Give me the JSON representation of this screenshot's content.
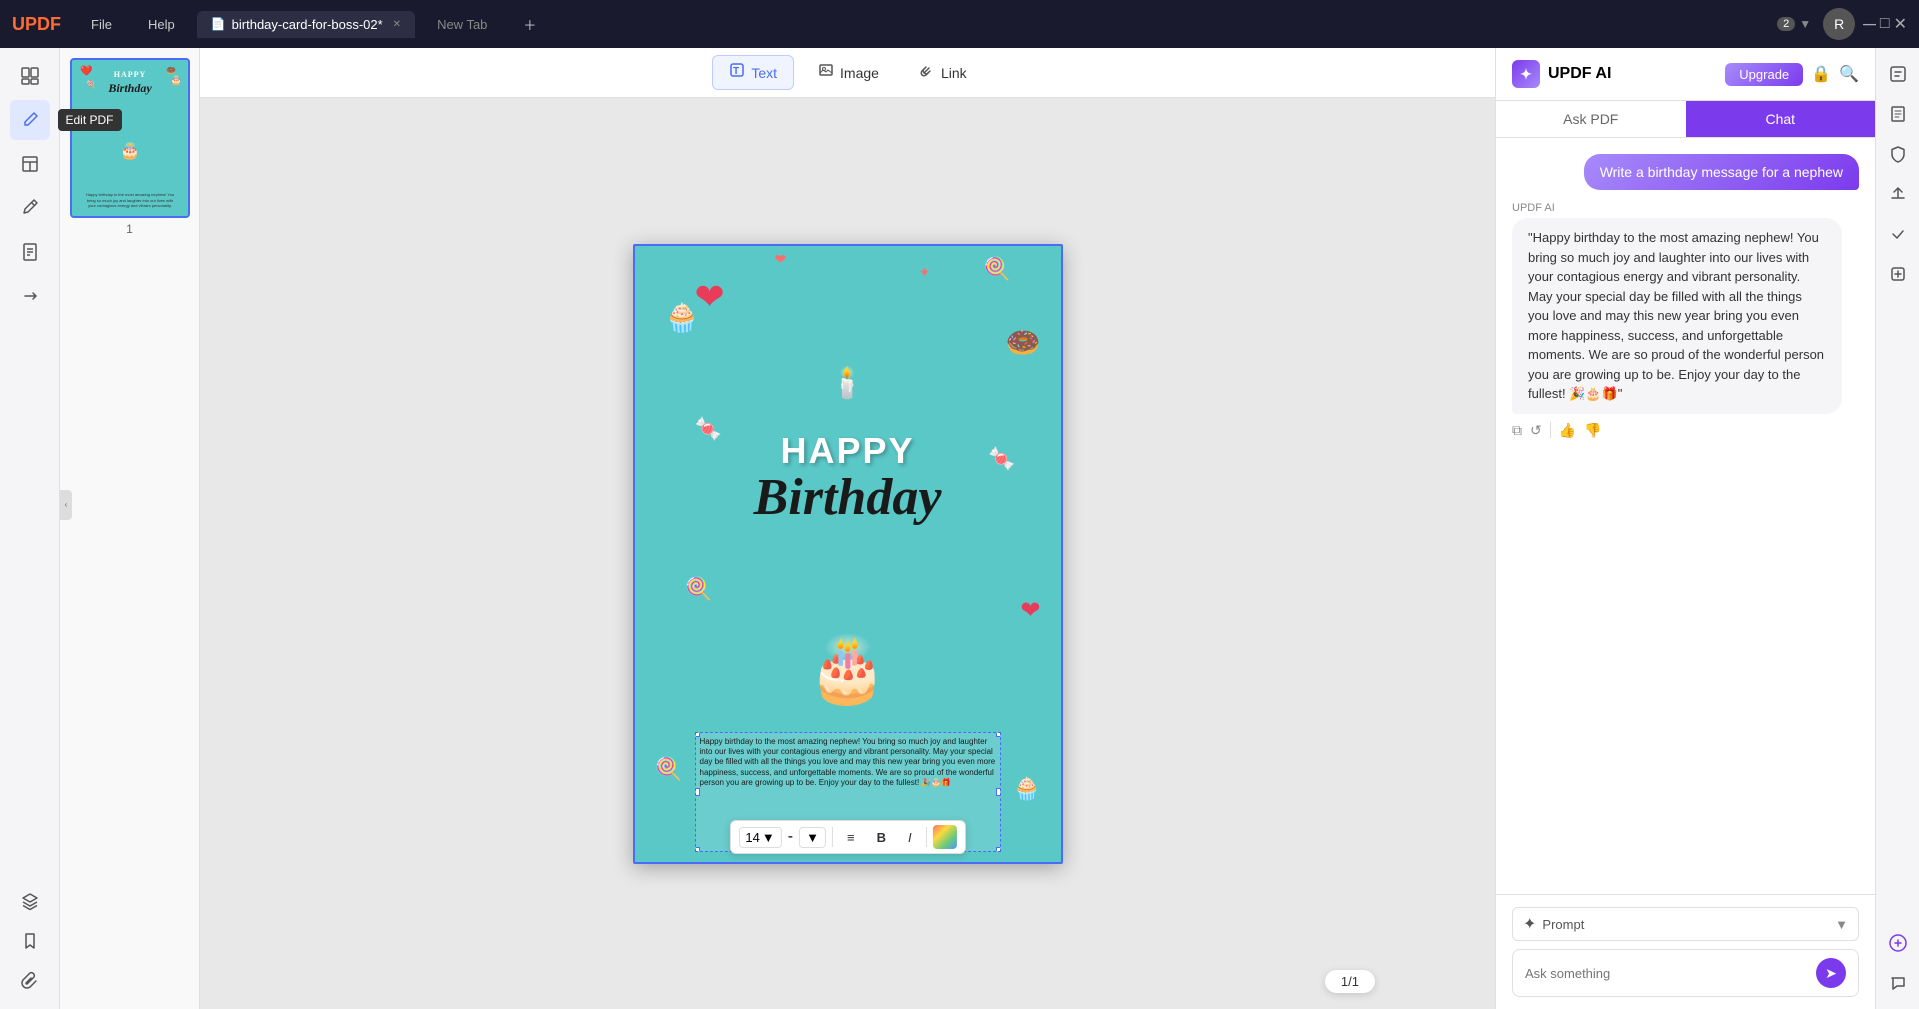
{
  "app": {
    "name": "UPDF",
    "logo_text": "UPDF"
  },
  "title_bar": {
    "file_btn": "File",
    "help_btn": "Help",
    "tab_name": "birthday-card-for-boss-02*",
    "new_tab": "New Tab",
    "count": "2"
  },
  "toolbar": {
    "text_label": "Text",
    "image_label": "Image",
    "link_label": "Link"
  },
  "sidebar": {
    "items": [
      {
        "name": "organize-pages",
        "icon": "⊞"
      },
      {
        "name": "edit-pdf",
        "icon": "✏️"
      },
      {
        "name": "layout-pages",
        "icon": "⊟"
      },
      {
        "name": "annotate",
        "icon": "📝"
      },
      {
        "name": "extract",
        "icon": "🗂️"
      },
      {
        "name": "convert",
        "icon": "🔄"
      }
    ],
    "bottom_items": [
      {
        "name": "layers",
        "icon": "◫"
      },
      {
        "name": "bookmark",
        "icon": "🔖"
      },
      {
        "name": "attachment",
        "icon": "📎"
      }
    ],
    "tooltip": "Edit PDF"
  },
  "thumbnail": {
    "page_number": "1",
    "card_happy": "HAPPY",
    "card_birthday": "Birthday",
    "card_body_text": "Happy birthday to the most amazing nephew! You bring so much joy and laughter into our lives with your contagious energy and vibrant personality."
  },
  "format_toolbar": {
    "font_size": "14",
    "dash": "-",
    "align_icon": "≡",
    "bold_label": "B",
    "italic_label": "I",
    "color_label": "🎨"
  },
  "pdf_content": {
    "happy_text": "HAPPY",
    "birthday_text": "Birthday",
    "body_text": "Happy birthday to the most amazing nephew! You bring so much joy and laughter into our lives with your contagious energy and vibrant personality. May your special day be filled with all the things you love and may this new year bring you even more happiness, success, and unforgettable moments. We are so proud of the wonderful person you are growing up to be. Enjoy your day to the fullest! 🎉🎂🎁"
  },
  "page_counter": {
    "current": "1",
    "total": "1",
    "display": "1/1"
  },
  "ai_panel": {
    "title": "UPDF AI",
    "upgrade_btn": "Upgrade",
    "tab_ask": "Ask PDF",
    "tab_chat": "Chat",
    "active_tab": "Chat",
    "user_message": "Write a birthday message for a nephew",
    "ai_sender": "UPDF AI",
    "ai_response": "\"Happy birthday to the most amazing nephew! You bring so much joy and laughter into our lives with your contagious energy and vibrant personality. May your special day be filled with all the things you love and may this new year bring you even more happiness, success, and unforgettable moments. We are so proud of the wonderful person you are growing up to be. Enjoy your day to the fullest! 🎉🎂🎁\"",
    "prompt_label": "Prompt",
    "input_placeholder": "Ask something"
  },
  "right_edge": {
    "icons": [
      "💾",
      "📄",
      "🔒",
      "⬆",
      "✓",
      "📊"
    ]
  },
  "colors": {
    "accent": "#7c3aed",
    "card_bg": "#5bc8c8",
    "active_tab_bg": "#7c3aed",
    "toolbar_active": "#f0f4ff"
  }
}
